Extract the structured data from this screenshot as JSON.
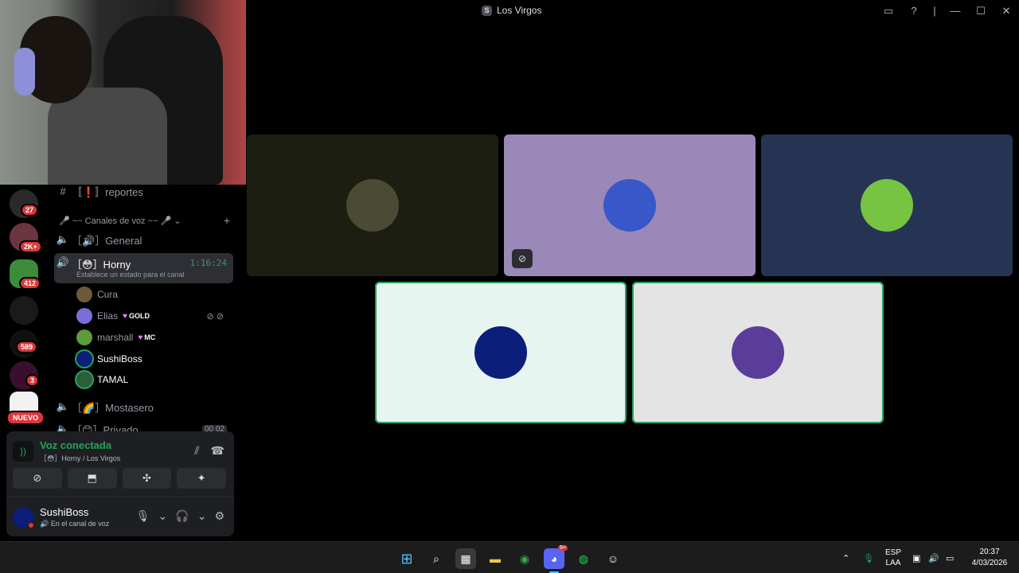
{
  "window": {
    "title": "Los Virgos",
    "server_badge": "S"
  },
  "rail": {
    "badges": [
      "27",
      "2K+",
      "412",
      "589",
      "3"
    ],
    "new_label": "NUEVO"
  },
  "channels": {
    "reportes": "〚❗〛reportes",
    "voice_category": "🎤 ~~ Canales de voz ~~ 🎤",
    "general": "［🔊］General",
    "horny": "［😳］Horny",
    "horny_timer": "1:16:24",
    "horny_status": "Establece un estado para el canal",
    "mostasero": "［🌈］Mostasero",
    "privado": "［😊］Privado",
    "privado_count": "00  02"
  },
  "users": [
    {
      "name": "Cura",
      "tag": "",
      "color": "#6b5a3a"
    },
    {
      "name": "Elias",
      "tag": "GOLD",
      "color": "#7a6fd8"
    },
    {
      "name": "marshall",
      "tag": "MC",
      "color": "#5e9c3b"
    },
    {
      "name": "SushiBoss",
      "tag": "",
      "color": "#0b1e7a"
    },
    {
      "name": "TAMAL",
      "tag": "",
      "color": "#2d5e3c"
    }
  ],
  "voice": {
    "connected_label": "Voz conectada",
    "channel_path": "［😳］Horny / Los Virgos"
  },
  "me": {
    "name": "SushiBoss",
    "status": "En el canal de voz"
  },
  "tiles": [
    {
      "bg": "#1d1e12",
      "avatar": "#4b4a35"
    },
    {
      "bg": "#9a89b8",
      "avatar": "#3858c9"
    },
    {
      "bg": "#263454",
      "avatar": "#76c442"
    },
    {
      "bg": "#e7f5f1",
      "avatar": "#0b1e7a"
    },
    {
      "bg": "#e4e4e4",
      "avatar": "#5a3d9a"
    }
  ],
  "taskbar": {
    "discord_badge": "9+",
    "lang_top": "ESP",
    "lang_bottom": "LAA",
    "time": "20:37",
    "date": "4/03/2026"
  }
}
